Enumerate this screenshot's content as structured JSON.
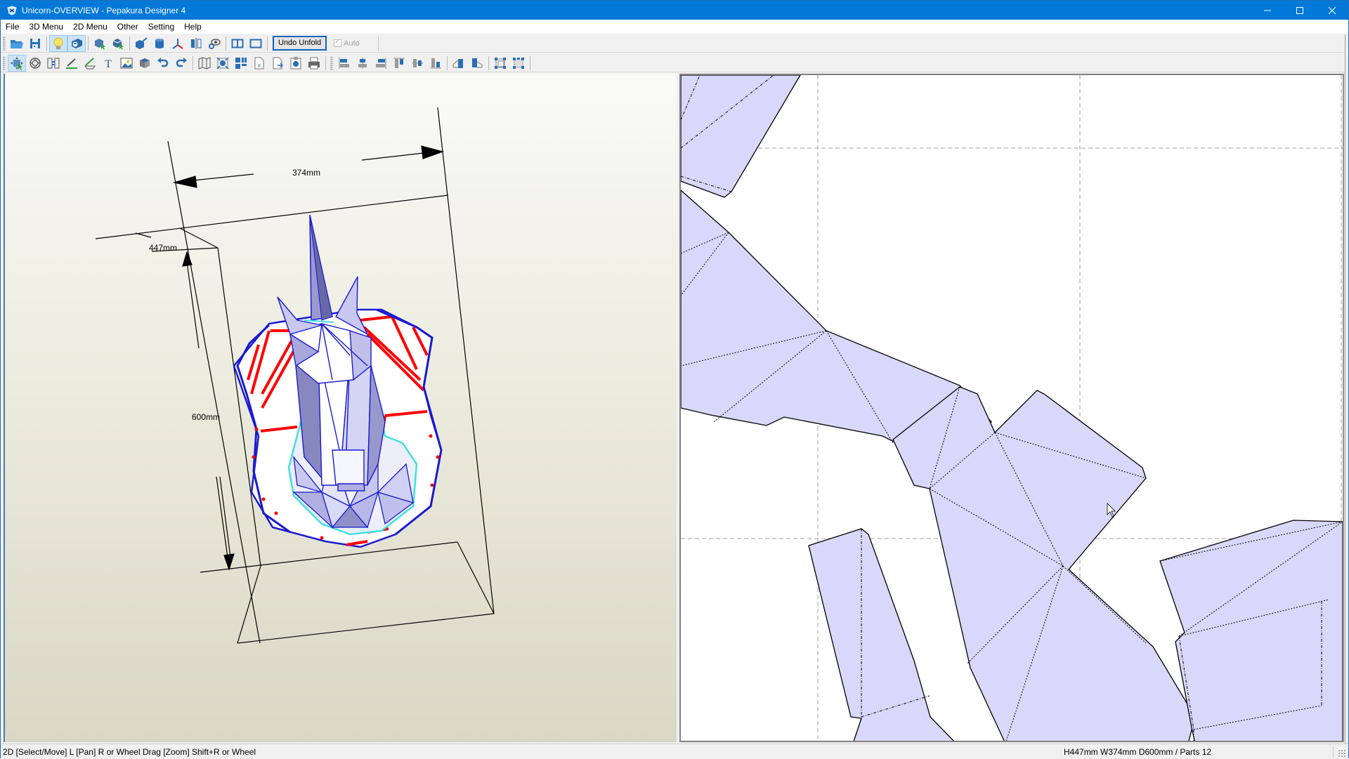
{
  "window": {
    "title": "Unicorn-OVERVIEW - Pepakura Designer 4",
    "controls": {
      "minimize": "minimize",
      "maximize": "maximize",
      "close": "close"
    }
  },
  "menu": {
    "items": [
      "File",
      "3D Menu",
      "2D Menu",
      "Other",
      "Setting",
      "Help"
    ]
  },
  "toolbar1": {
    "buttons": [
      {
        "name": "open-icon",
        "label": "Open"
      },
      {
        "name": "save-icon",
        "label": "Save"
      },
      {
        "name": "light-icon",
        "label": "Lighting",
        "active": true
      },
      {
        "name": "texture-icon",
        "label": "Show Texture",
        "active": true
      },
      {
        "name": "select-part-icon",
        "label": "Select 3D Part"
      },
      {
        "name": "select-face-icon",
        "label": "Select Face"
      },
      {
        "name": "cube-edit-icon",
        "label": "Edit Model"
      },
      {
        "name": "cylinder-icon",
        "label": "Cylinder"
      },
      {
        "name": "axis-icon",
        "label": "Axis"
      },
      {
        "name": "mirror-icon",
        "label": "Mirror"
      },
      {
        "name": "view-icon",
        "label": "View"
      },
      {
        "name": "split-view-icon",
        "label": "Split View"
      },
      {
        "name": "single-view-icon",
        "label": "Single View"
      }
    ],
    "undo_unfold_label": "Undo Unfold",
    "auto_label": "Auto",
    "auto_checked": true
  },
  "toolbar2": {
    "buttons": [
      {
        "name": "select-move-icon",
        "label": "Select/Move",
        "active": true
      },
      {
        "name": "rotate-icon",
        "label": "Rotate"
      },
      {
        "name": "join-parts-icon",
        "label": "Join/Disjoin"
      },
      {
        "name": "edit-flap-icon",
        "label": "Edit Flap"
      },
      {
        "name": "edit-line-icon",
        "label": "Edit Fold Line"
      },
      {
        "name": "text-icon",
        "label": "Text"
      },
      {
        "name": "image-icon",
        "label": "Image"
      },
      {
        "name": "box-icon",
        "label": "Box"
      },
      {
        "name": "undo-icon",
        "label": "Undo"
      },
      {
        "name": "redo-icon",
        "label": "Redo"
      },
      {
        "name": "unfold-icon",
        "label": "Unfold"
      },
      {
        "name": "fit-icon",
        "label": "Fit"
      },
      {
        "name": "arrange-icon",
        "label": "Arrange"
      },
      {
        "name": "page-number-icon",
        "label": "Page Number"
      },
      {
        "name": "page-export-icon",
        "label": "Export Page"
      },
      {
        "name": "clipboard-icon",
        "label": "Copy"
      },
      {
        "name": "print-icon",
        "label": "Print"
      },
      {
        "name": "align-left-icon",
        "label": "Align Left"
      },
      {
        "name": "align-center-icon",
        "label": "Align Center"
      },
      {
        "name": "align-right-icon",
        "label": "Align Right"
      },
      {
        "name": "align-top-icon",
        "label": "Align Top"
      },
      {
        "name": "align-middle-icon",
        "label": "Align Middle"
      },
      {
        "name": "align-bottom-icon",
        "label": "Align Bottom"
      },
      {
        "name": "flip-h-icon",
        "label": "Flip Horizontal"
      },
      {
        "name": "flip-v-icon",
        "label": "Flip Vertical"
      },
      {
        "name": "group-icon",
        "label": "Group"
      },
      {
        "name": "ungroup-icon",
        "label": "Ungroup"
      }
    ]
  },
  "view3d": {
    "dimensions": {
      "width": "374mm",
      "height": "447mm",
      "depth": "600mm"
    },
    "colors": {
      "edge": "#1a1ad0",
      "cut_edge": "#ff0000",
      "face": "#b8b8e8",
      "seam": "#40e0e0"
    }
  },
  "view2d": {
    "piece_fill": "#d8d8fa",
    "grid_color": "#a0a0a0"
  },
  "status": {
    "hint": "2D [Select/Move] L [Pan] R or Wheel Drag [Zoom] Shift+R or Wheel",
    "info": "H447mm W374mm D600mm / Parts 12"
  }
}
